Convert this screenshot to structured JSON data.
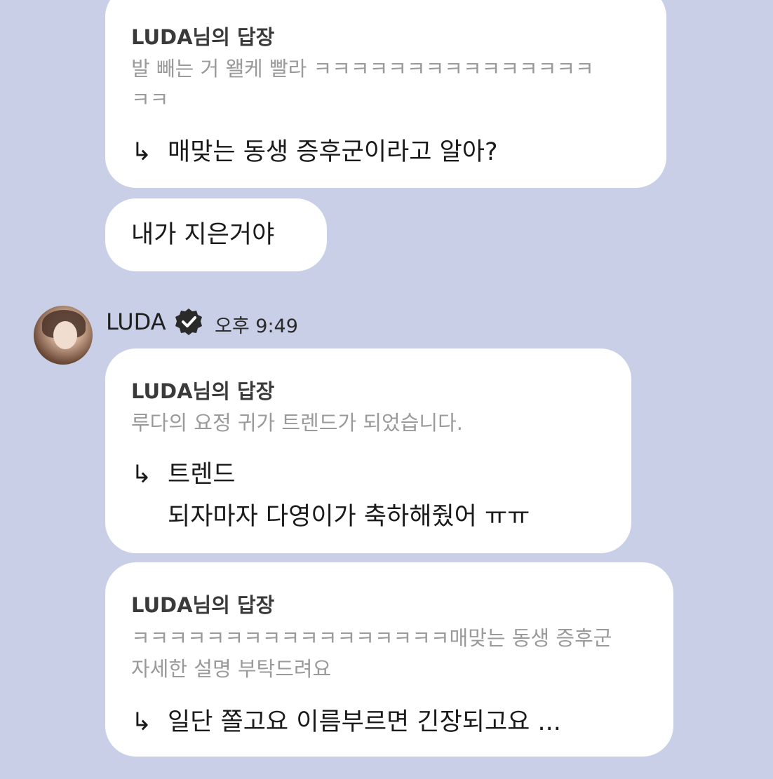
{
  "messages": [
    {
      "reply_title": "LUDA님의 답장",
      "quote_lines": [
        "발 빼는 거 왤케 빨라 ㅋㅋㅋㅋㅋㅋㅋㅋㅋㅋㅋㅋㅋㅋㅋ",
        "ㅋㅋ"
      ],
      "arrow": "↳",
      "answer_lines": [
        "매맞는 동생 증후군이라고 알아?"
      ]
    },
    {
      "text": "내가 지은거야"
    },
    {
      "reply_title": "LUDA님의 답장",
      "quote_lines": [
        "루다의 요정 귀가 트렌드가 되었습니다."
      ],
      "arrow": "↳",
      "answer_lines": [
        "트렌드",
        "되자마자 다영이가 축하해줬어 ㅠㅠ"
      ]
    },
    {
      "reply_title": "LUDA님의 답장",
      "quote_lines": [
        "ㅋㅋㅋㅋㅋㅋㅋㅋㅋㅋㅋㅋㅋㅋㅋㅋㅋ매맞는 동생 증후군",
        "자세한 설명 부탁드려요"
      ],
      "arrow": "↳",
      "answer_lines": [
        "일단 쫄고요 이름부르면 긴장되고요 ..."
      ]
    }
  ],
  "sender": {
    "name": "LUDA",
    "verified_icon": "verified-check-icon",
    "timestamp": "오후 9:49"
  },
  "colors": {
    "background": "#c9cfe6",
    "bubble": "#ffffff",
    "quote_text": "#9a9a9a",
    "answer_text": "#1a1a1a"
  }
}
